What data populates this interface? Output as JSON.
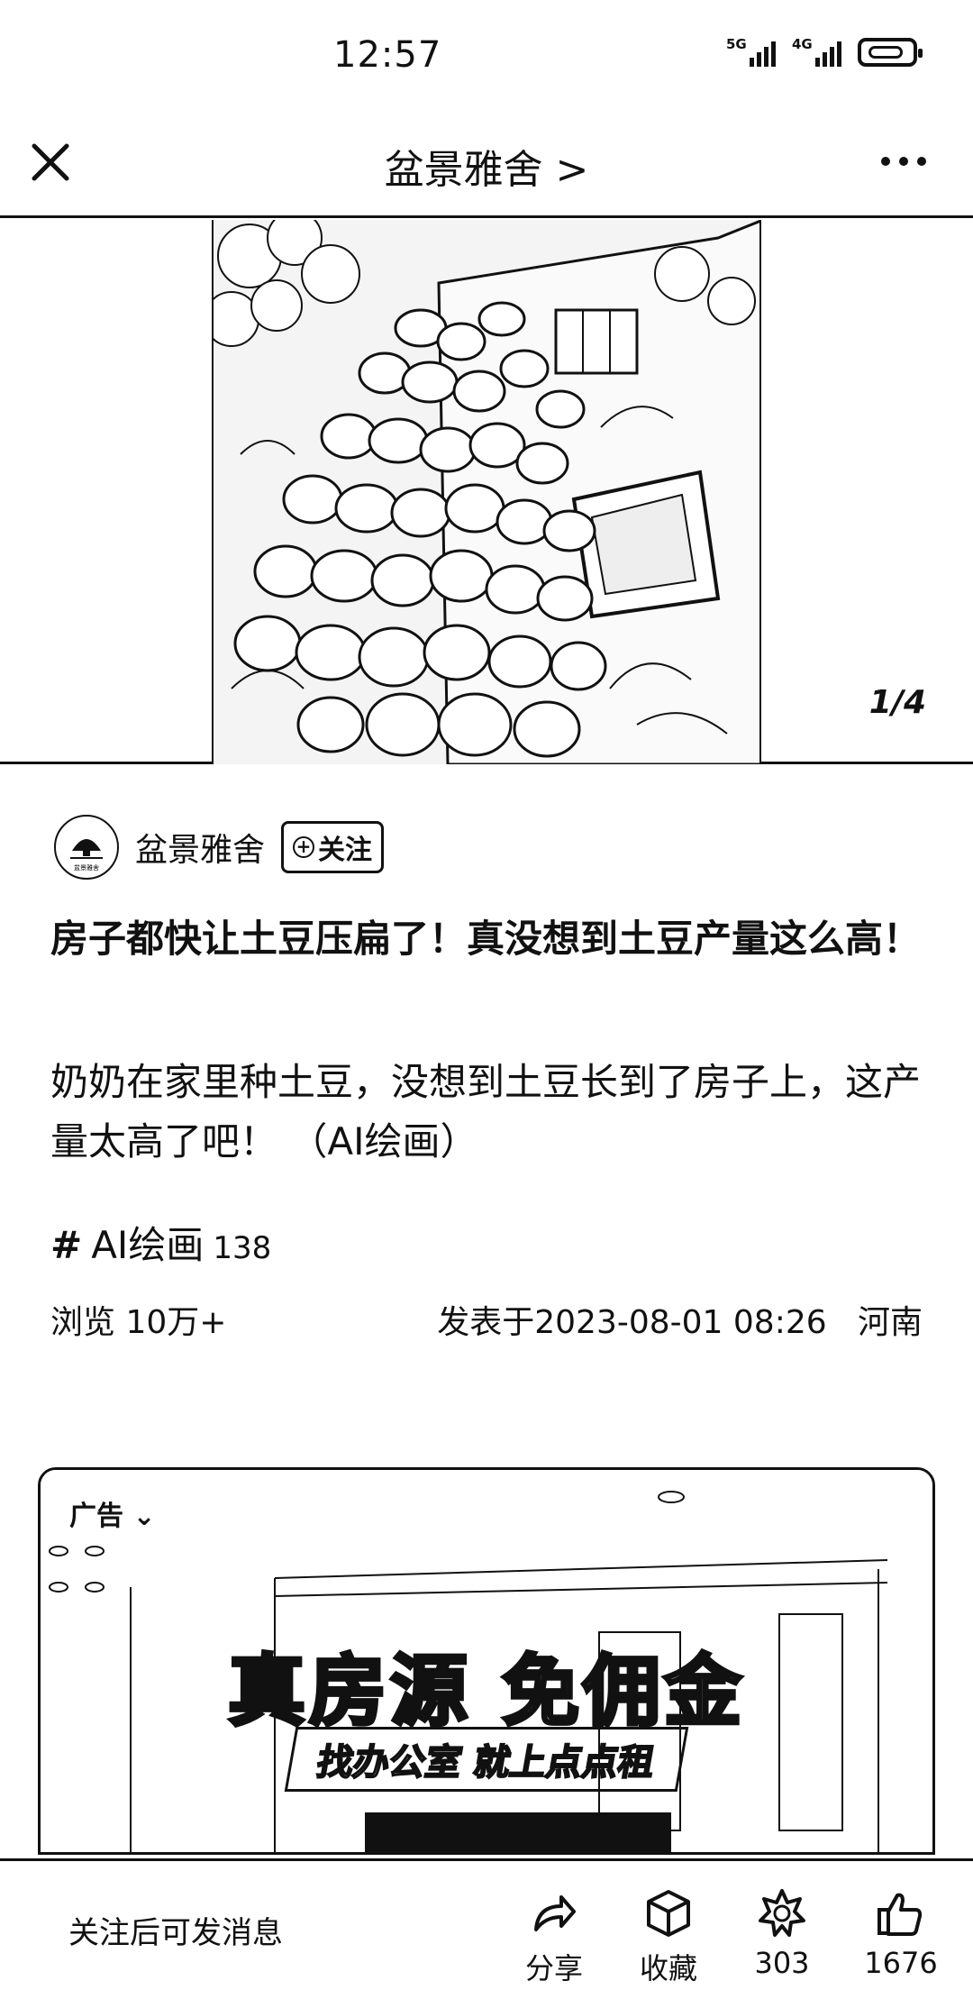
{
  "status_bar": {
    "time": "12:57",
    "network1": "5G",
    "network2": "4G",
    "icons": [
      "signal-5g-icon",
      "signal-4g-icon",
      "battery-icon"
    ]
  },
  "header": {
    "title": "盆景雅舍 >",
    "icons": [
      "close-icon",
      "more-icon"
    ]
  },
  "gallery": {
    "counter": "1/4"
  },
  "author": {
    "name": "盆景雅舍",
    "avatar_text": "盆景雅舍",
    "follow_label": "关注"
  },
  "post": {
    "title": "房子都快让土豆压扁了！真没想到土豆产量这么高！",
    "body": "奶奶在家里种土豆，没想到土豆长到了房子上，这产量太高了吧！ （AI绘画）",
    "tag_hash": "#",
    "tag": "AI绘画",
    "tag_count": "138",
    "views": "浏览 10万+",
    "published": "发表于2023-08-01 08:26",
    "location": "河南"
  },
  "ad": {
    "label": "广告",
    "headline": "真房源 免佣金",
    "subline": "找办公室 就上点点租"
  },
  "bottom_bar": {
    "message_hint": "关注后可发消息",
    "share_label": "分享",
    "collect_label": "收藏",
    "comment_count": "303",
    "like_count": "1676"
  }
}
